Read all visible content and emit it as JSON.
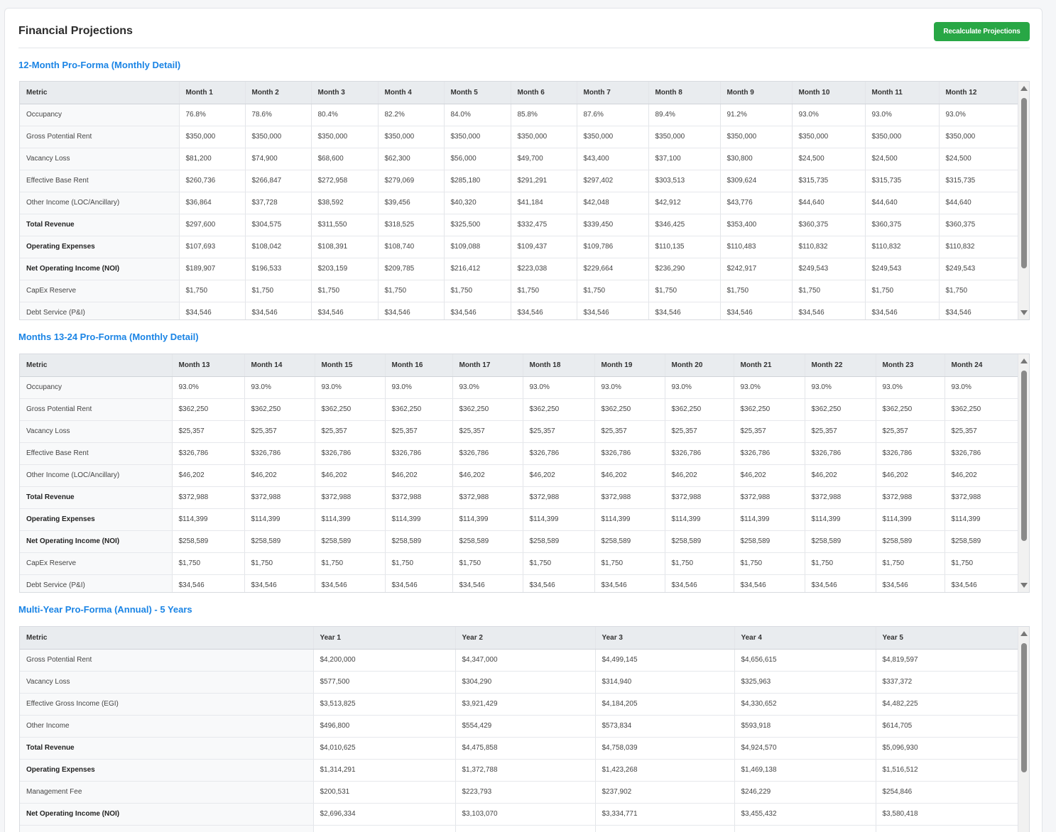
{
  "header": {
    "title": "Financial Projections",
    "recalc_label": "Recalculate Projections",
    "accent_color": "#28a745"
  },
  "section1": {
    "title": "12-Month Pro-Forma (Monthly Detail)",
    "headers": [
      "Metric",
      "Month 1",
      "Month 2",
      "Month 3",
      "Month 4",
      "Month 5",
      "Month 6",
      "Month 7",
      "Month 8",
      "Month 9",
      "Month 10",
      "Month 11",
      "Month 12"
    ],
    "rows": [
      {
        "bold": false,
        "cells": [
          "Occupancy",
          "76.8%",
          "78.6%",
          "80.4%",
          "82.2%",
          "84.0%",
          "85.8%",
          "87.6%",
          "89.4%",
          "91.2%",
          "93.0%",
          "93.0%",
          "93.0%"
        ]
      },
      {
        "bold": false,
        "cells": [
          "Gross Potential Rent",
          "$350,000",
          "$350,000",
          "$350,000",
          "$350,000",
          "$350,000",
          "$350,000",
          "$350,000",
          "$350,000",
          "$350,000",
          "$350,000",
          "$350,000",
          "$350,000"
        ]
      },
      {
        "bold": false,
        "cells": [
          "Vacancy Loss",
          "$81,200",
          "$74,900",
          "$68,600",
          "$62,300",
          "$56,000",
          "$49,700",
          "$43,400",
          "$37,100",
          "$30,800",
          "$24,500",
          "$24,500",
          "$24,500"
        ]
      },
      {
        "bold": false,
        "cells": [
          "Effective Base Rent",
          "$260,736",
          "$266,847",
          "$272,958",
          "$279,069",
          "$285,180",
          "$291,291",
          "$297,402",
          "$303,513",
          "$309,624",
          "$315,735",
          "$315,735",
          "$315,735"
        ]
      },
      {
        "bold": false,
        "cells": [
          "Other Income (LOC/Ancillary)",
          "$36,864",
          "$37,728",
          "$38,592",
          "$39,456",
          "$40,320",
          "$41,184",
          "$42,048",
          "$42,912",
          "$43,776",
          "$44,640",
          "$44,640",
          "$44,640"
        ]
      },
      {
        "bold": true,
        "cells": [
          "Total Revenue",
          "$297,600",
          "$304,575",
          "$311,550",
          "$318,525",
          "$325,500",
          "$332,475",
          "$339,450",
          "$346,425",
          "$353,400",
          "$360,375",
          "$360,375",
          "$360,375"
        ]
      },
      {
        "bold": true,
        "cells": [
          "Operating Expenses",
          "$107,693",
          "$108,042",
          "$108,391",
          "$108,740",
          "$109,088",
          "$109,437",
          "$109,786",
          "$110,135",
          "$110,483",
          "$110,832",
          "$110,832",
          "$110,832"
        ]
      },
      {
        "bold": true,
        "cells": [
          "Net Operating Income (NOI)",
          "$189,907",
          "$196,533",
          "$203,159",
          "$209,785",
          "$216,412",
          "$223,038",
          "$229,664",
          "$236,290",
          "$242,917",
          "$249,543",
          "$249,543",
          "$249,543"
        ]
      },
      {
        "bold": false,
        "cells": [
          "CapEx Reserve",
          "$1,750",
          "$1,750",
          "$1,750",
          "$1,750",
          "$1,750",
          "$1,750",
          "$1,750",
          "$1,750",
          "$1,750",
          "$1,750",
          "$1,750",
          "$1,750"
        ]
      },
      {
        "bold": false,
        "cells": [
          "Debt Service (P&I)",
          "$34,546",
          "$34,546",
          "$34,546",
          "$34,546",
          "$34,546",
          "$34,546",
          "$34,546",
          "$34,546",
          "$34,546",
          "$34,546",
          "$34,546",
          "$34,546"
        ]
      }
    ]
  },
  "section2": {
    "title": "Months 13-24 Pro-Forma (Monthly Detail)",
    "headers": [
      "Metric",
      "Month 13",
      "Month 14",
      "Month 15",
      "Month 16",
      "Month 17",
      "Month 18",
      "Month 19",
      "Month 20",
      "Month 21",
      "Month 22",
      "Month 23",
      "Month 24"
    ],
    "rows": [
      {
        "bold": false,
        "cells": [
          "Occupancy",
          "93.0%",
          "93.0%",
          "93.0%",
          "93.0%",
          "93.0%",
          "93.0%",
          "93.0%",
          "93.0%",
          "93.0%",
          "93.0%",
          "93.0%",
          "93.0%"
        ]
      },
      {
        "bold": false,
        "cells": [
          "Gross Potential Rent",
          "$362,250",
          "$362,250",
          "$362,250",
          "$362,250",
          "$362,250",
          "$362,250",
          "$362,250",
          "$362,250",
          "$362,250",
          "$362,250",
          "$362,250",
          "$362,250"
        ]
      },
      {
        "bold": false,
        "cells": [
          "Vacancy Loss",
          "$25,357",
          "$25,357",
          "$25,357",
          "$25,357",
          "$25,357",
          "$25,357",
          "$25,357",
          "$25,357",
          "$25,357",
          "$25,357",
          "$25,357",
          "$25,357"
        ]
      },
      {
        "bold": false,
        "cells": [
          "Effective Base Rent",
          "$326,786",
          "$326,786",
          "$326,786",
          "$326,786",
          "$326,786",
          "$326,786",
          "$326,786",
          "$326,786",
          "$326,786",
          "$326,786",
          "$326,786",
          "$326,786"
        ]
      },
      {
        "bold": false,
        "cells": [
          "Other Income (LOC/Ancillary)",
          "$46,202",
          "$46,202",
          "$46,202",
          "$46,202",
          "$46,202",
          "$46,202",
          "$46,202",
          "$46,202",
          "$46,202",
          "$46,202",
          "$46,202",
          "$46,202"
        ]
      },
      {
        "bold": true,
        "cells": [
          "Total Revenue",
          "$372,988",
          "$372,988",
          "$372,988",
          "$372,988",
          "$372,988",
          "$372,988",
          "$372,988",
          "$372,988",
          "$372,988",
          "$372,988",
          "$372,988",
          "$372,988"
        ]
      },
      {
        "bold": true,
        "cells": [
          "Operating Expenses",
          "$114,399",
          "$114,399",
          "$114,399",
          "$114,399",
          "$114,399",
          "$114,399",
          "$114,399",
          "$114,399",
          "$114,399",
          "$114,399",
          "$114,399",
          "$114,399"
        ]
      },
      {
        "bold": true,
        "cells": [
          "Net Operating Income (NOI)",
          "$258,589",
          "$258,589",
          "$258,589",
          "$258,589",
          "$258,589",
          "$258,589",
          "$258,589",
          "$258,589",
          "$258,589",
          "$258,589",
          "$258,589",
          "$258,589"
        ]
      },
      {
        "bold": false,
        "cells": [
          "CapEx Reserve",
          "$1,750",
          "$1,750",
          "$1,750",
          "$1,750",
          "$1,750",
          "$1,750",
          "$1,750",
          "$1,750",
          "$1,750",
          "$1,750",
          "$1,750",
          "$1,750"
        ]
      },
      {
        "bold": false,
        "cells": [
          "Debt Service (P&I)",
          "$34,546",
          "$34,546",
          "$34,546",
          "$34,546",
          "$34,546",
          "$34,546",
          "$34,546",
          "$34,546",
          "$34,546",
          "$34,546",
          "$34,546",
          "$34,546"
        ]
      }
    ]
  },
  "section3": {
    "title": "Multi-Year Pro-Forma (Annual) - 5 Years",
    "headers": [
      "Metric",
      "Year 1",
      "Year 2",
      "Year 3",
      "Year 4",
      "Year 5"
    ],
    "rows": [
      {
        "bold": false,
        "cells": [
          "Gross Potential Rent",
          "$4,200,000",
          "$4,347,000",
          "$4,499,145",
          "$4,656,615",
          "$4,819,597"
        ]
      },
      {
        "bold": false,
        "cells": [
          "Vacancy Loss",
          "$577,500",
          "$304,290",
          "$314,940",
          "$325,963",
          "$337,372"
        ]
      },
      {
        "bold": false,
        "cells": [
          "Effective Gross Income (EGI)",
          "$3,513,825",
          "$3,921,429",
          "$4,184,205",
          "$4,330,652",
          "$4,482,225"
        ]
      },
      {
        "bold": false,
        "cells": [
          "Other Income",
          "$496,800",
          "$554,429",
          "$573,834",
          "$593,918",
          "$614,705"
        ]
      },
      {
        "bold": true,
        "cells": [
          "Total Revenue",
          "$4,010,625",
          "$4,475,858",
          "$4,758,039",
          "$4,924,570",
          "$5,096,930"
        ]
      },
      {
        "bold": true,
        "cells": [
          "Operating Expenses",
          "$1,314,291",
          "$1,372,788",
          "$1,423,268",
          "$1,469,138",
          "$1,516,512"
        ]
      },
      {
        "bold": false,
        "cells": [
          "Management Fee",
          "$200,531",
          "$223,793",
          "$237,902",
          "$246,229",
          "$254,846"
        ]
      },
      {
        "bold": true,
        "cells": [
          "Net Operating Income (NOI)",
          "$2,696,334",
          "$3,103,070",
          "$3,334,771",
          "$3,455,432",
          "$3,580,418"
        ]
      },
      {
        "bold": false,
        "cells": [
          "",
          "",
          "",
          "",
          "",
          ""
        ]
      }
    ]
  }
}
